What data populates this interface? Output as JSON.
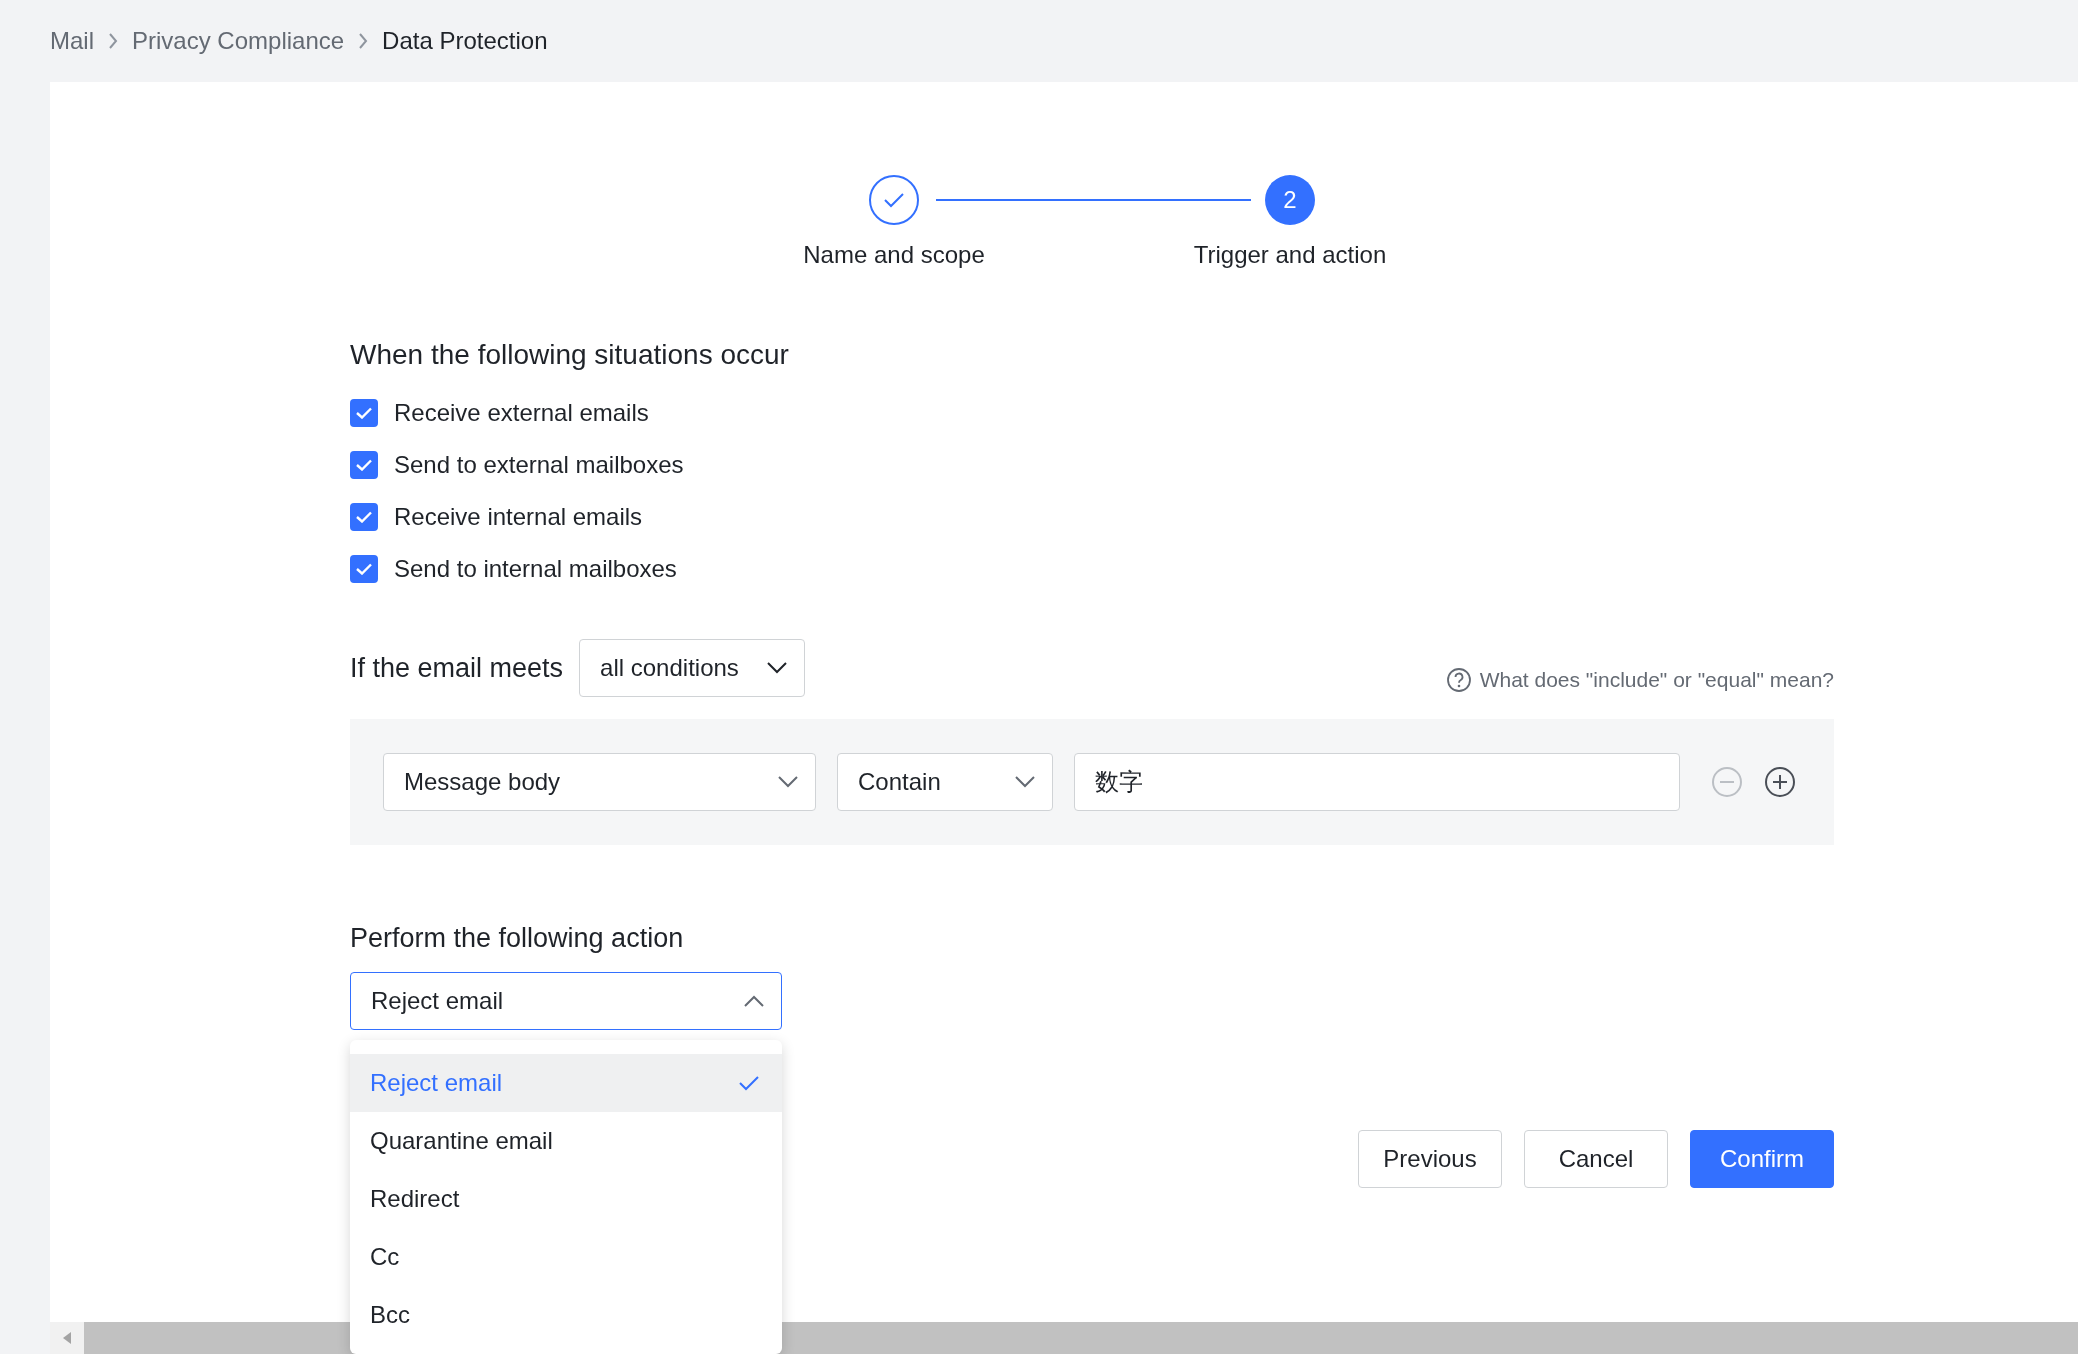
{
  "breadcrumb": [
    {
      "label": "Mail"
    },
    {
      "label": "Privacy Compliance"
    },
    {
      "label": "Data Protection"
    }
  ],
  "steps": [
    {
      "label": "Name and scope",
      "completed": true
    },
    {
      "label": "Trigger and action",
      "completed": false,
      "number": "2"
    }
  ],
  "situations": {
    "title": "When the following situations occur",
    "options": [
      {
        "label": "Receive external emails",
        "checked": true
      },
      {
        "label": "Send to external mailboxes",
        "checked": true
      },
      {
        "label": "Receive internal emails",
        "checked": true
      },
      {
        "label": "Send to internal mailboxes",
        "checked": true
      }
    ]
  },
  "conditions": {
    "label": "If the email meets",
    "match": "all conditions",
    "help": "What does \"include\" or \"equal\" mean?",
    "rows": [
      {
        "field": "Message body",
        "operator": "Contain",
        "value": "数字",
        "remove_disabled": true
      }
    ]
  },
  "action": {
    "title": "Perform the following action",
    "value": "Reject email",
    "expanded": true,
    "options": [
      {
        "label": "Reject email",
        "selected": true
      },
      {
        "label": "Quarantine email",
        "selected": false
      },
      {
        "label": "Redirect",
        "selected": false
      },
      {
        "label": "Cc",
        "selected": false
      },
      {
        "label": "Bcc",
        "selected": false
      }
    ]
  },
  "buttons": [
    {
      "label": "Previous",
      "kind": "default"
    },
    {
      "label": "Cancel",
      "kind": "default"
    },
    {
      "label": "Confirm",
      "kind": "primary"
    }
  ]
}
